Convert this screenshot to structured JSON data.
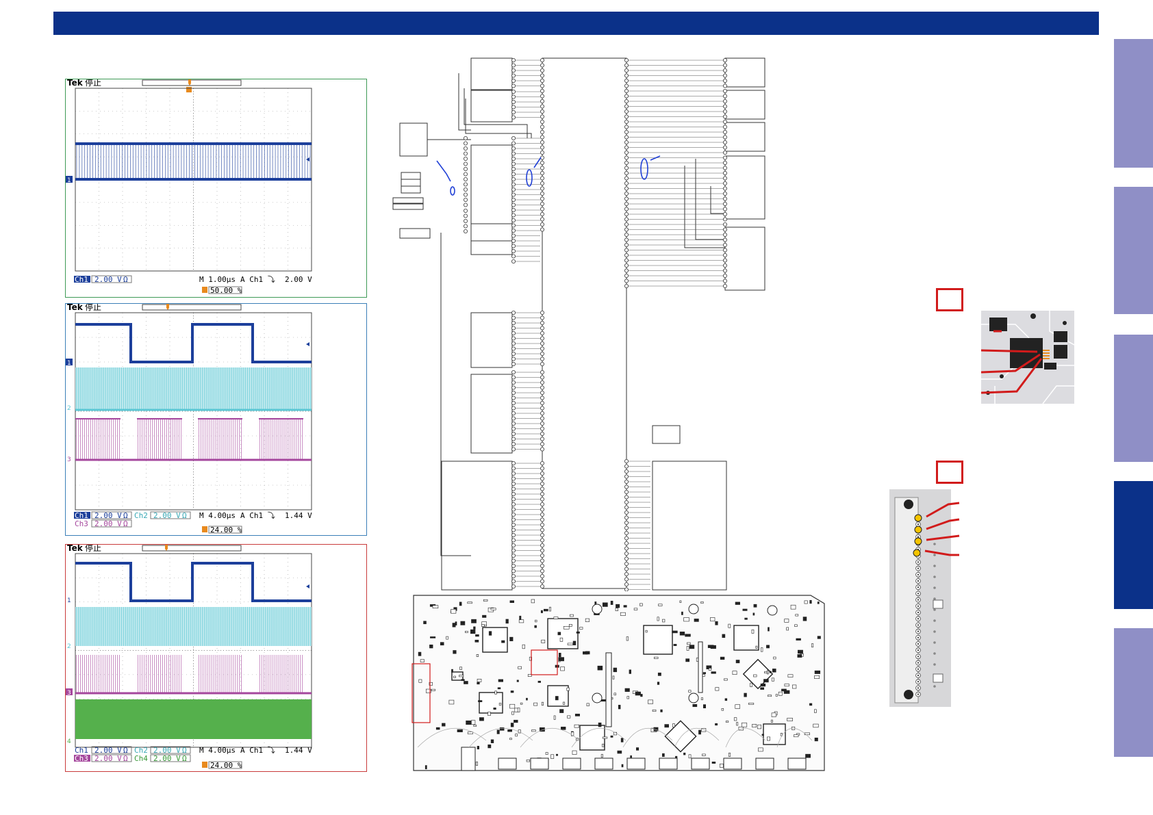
{
  "colors": {
    "band": "#0b3189",
    "tab_inactive": "#8f8fc6",
    "tab_active": "#0b3189",
    "ch1": "#1c3f9b",
    "ch2": "#5bc7d4",
    "ch3": "#a5479d",
    "ch4": "#55b04c",
    "frame1": "#3d9a55",
    "frame2": "#3a7fb8",
    "frame3": "#c93a3a",
    "callout": "#d11b1b"
  },
  "side_tabs": [
    {
      "state": "inactive"
    },
    {
      "state": "inactive"
    },
    {
      "state": "inactive"
    },
    {
      "state": "active"
    },
    {
      "state": "inactive"
    }
  ],
  "scopes": [
    {
      "brand": "Tek",
      "status": "停止",
      "bottom_row1": {
        "ch": "Ch1",
        "volts": "2.00 V",
        "ohm": "Ω",
        "time": "M 1.00µs",
        "trig": "A  Ch1  ⤵",
        "level": "2.00 V"
      },
      "bottom_row2": null,
      "trig_pos": "50.00 %",
      "channel_markers": [
        "1"
      ]
    },
    {
      "brand": "Tek",
      "status": "停止",
      "bottom_row1": {
        "ch": "Ch1",
        "volts": "2.00 V",
        "ohm": "Ω",
        "ch_b": "Ch2",
        "volts_b": "2.00 V",
        "ohm_b": "Ω",
        "time": "M 4.00µs",
        "trig": "A  Ch1  ⤵",
        "level": "1.44 V"
      },
      "bottom_row2": {
        "ch": "Ch3",
        "volts": "2.00 V",
        "ohm": "Ω"
      },
      "trig_pos": "24.00 %",
      "channel_markers": [
        "1",
        "2",
        "3"
      ]
    },
    {
      "brand": "Tek",
      "status": "停止",
      "bottom_row1": {
        "ch": "Ch1",
        "volts": "2.00 V",
        "ohm": "Ω",
        "ch_b": "Ch2",
        "volts_b": "2.00 V",
        "ohm_b": "Ω",
        "time": "M 4.00µs",
        "trig": "A  Ch1  ⤵",
        "level": "1.44 V"
      },
      "bottom_row2": {
        "ch": "Ch3",
        "volts": "2.00 V",
        "ohm": "Ω",
        "ch_b": "Ch4",
        "volts_b": "2.00 V",
        "ohm_b": "Ω"
      },
      "trig_pos": "24.00 %",
      "channel_markers": [
        "1",
        "2",
        "3",
        "4"
      ]
    }
  ]
}
